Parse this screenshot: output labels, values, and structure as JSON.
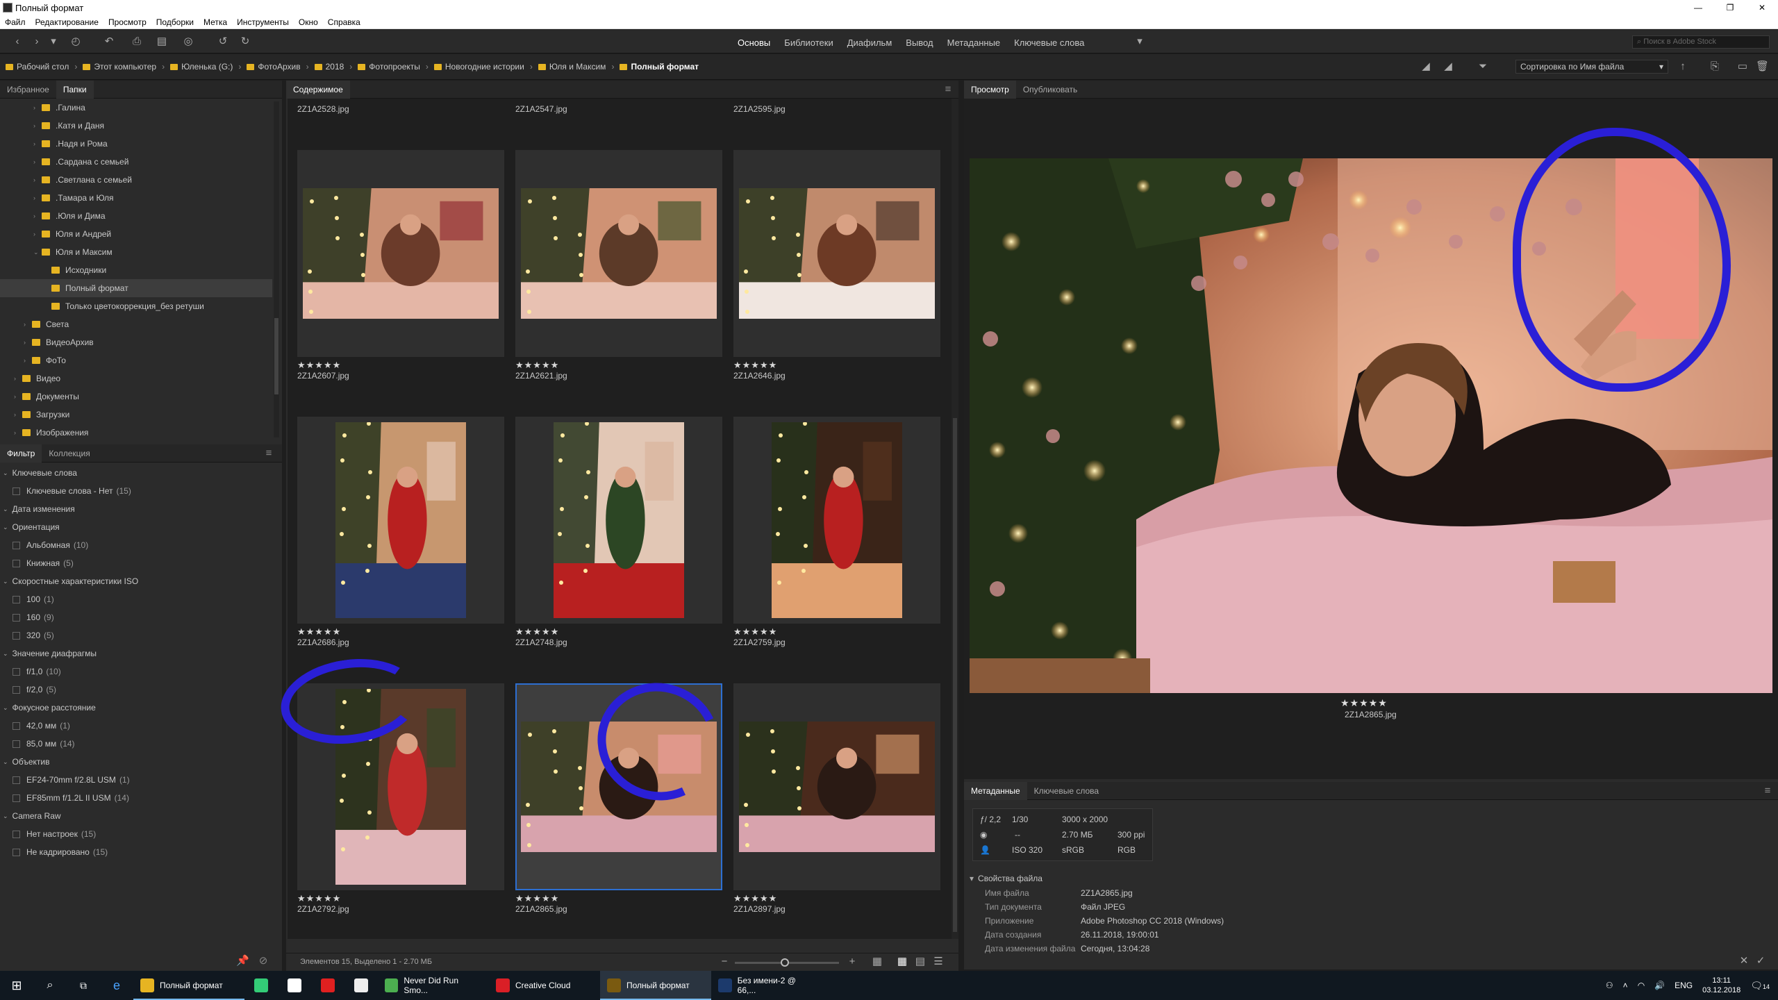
{
  "window": {
    "title": "Полный формат"
  },
  "menu": [
    "Файл",
    "Редактирование",
    "Просмотр",
    "Подборки",
    "Метка",
    "Инструменты",
    "Окно",
    "Справка"
  ],
  "workspaces": [
    "Основы",
    "Библиотеки",
    "Диафильм",
    "Вывод",
    "Метаданные",
    "Ключевые слова"
  ],
  "stock_placeholder": "Поиск в Adobe Stock",
  "breadcrumb": [
    "Рабочий стол",
    "Этот компьютер",
    "Юленька (G:)",
    "ФотоАрхив",
    "2018",
    "Фотопроекты",
    "Новогодние истории",
    "Юля и Максим",
    "Полный формат"
  ],
  "sort_label": "Сортировка по Имя файла",
  "left_tabs": [
    "Избранное",
    "Папки"
  ],
  "folders": [
    {
      "label": ".Галина",
      "indent": 2,
      "sel": false
    },
    {
      "label": ".Катя и Даня",
      "indent": 2,
      "sel": false
    },
    {
      "label": ".Надя и Рома",
      "indent": 2,
      "sel": false
    },
    {
      "label": ".Сардана с семьей",
      "indent": 2,
      "sel": false
    },
    {
      "label": ".Светлана с семьей",
      "indent": 2,
      "sel": false
    },
    {
      "label": ".Тамара и Юля",
      "indent": 2,
      "sel": false
    },
    {
      "label": ".Юля и Дима",
      "indent": 2,
      "sel": false
    },
    {
      "label": "Юля и Андрей",
      "indent": 2,
      "sel": false
    },
    {
      "label": "Юля и Максим",
      "indent": 2,
      "sel": false
    },
    {
      "label": "Исходники",
      "indent": 3,
      "sel": false
    },
    {
      "label": "Полный формат",
      "indent": 3,
      "sel": true
    },
    {
      "label": "Только цветокоррекция_без ретуши",
      "indent": 3,
      "sel": false
    },
    {
      "label": "Света",
      "indent": 1,
      "sel": false
    },
    {
      "label": "ВидеоАрхив",
      "indent": 1,
      "sel": false
    },
    {
      "label": "ФоТо",
      "indent": 1,
      "sel": false
    },
    {
      "label": "Видео",
      "indent": 0,
      "sel": false
    },
    {
      "label": "Документы",
      "indent": 0,
      "sel": false
    },
    {
      "label": "Загрузки",
      "indent": 0,
      "sel": false
    },
    {
      "label": "Изображения",
      "indent": 0,
      "sel": false
    }
  ],
  "filter_tabs": [
    "Фильтр",
    "Коллекция"
  ],
  "filters": [
    {
      "type": "h",
      "label": "Ключевые слова"
    },
    {
      "type": "i",
      "label": "Ключевые слова - Нет",
      "count": "(15)"
    },
    {
      "type": "h",
      "label": "Дата изменения"
    },
    {
      "type": "h",
      "label": "Ориентация"
    },
    {
      "type": "i",
      "label": "Альбомная",
      "count": "(10)"
    },
    {
      "type": "i",
      "label": "Книжная",
      "count": "(5)"
    },
    {
      "type": "h",
      "label": "Скоростные характеристики ISO"
    },
    {
      "type": "i",
      "label": "100",
      "count": "(1)"
    },
    {
      "type": "i",
      "label": "160",
      "count": "(9)"
    },
    {
      "type": "i",
      "label": "320",
      "count": "(5)"
    },
    {
      "type": "h",
      "label": "Значение диафрагмы"
    },
    {
      "type": "i",
      "label": "f/1,0",
      "count": "(10)"
    },
    {
      "type": "i",
      "label": "f/2,0",
      "count": "(5)"
    },
    {
      "type": "h",
      "label": "Фокусное расстояние"
    },
    {
      "type": "i",
      "label": "42,0 мм",
      "count": "(1)"
    },
    {
      "type": "i",
      "label": "85,0 мм",
      "count": "(14)"
    },
    {
      "type": "h",
      "label": "Объектив"
    },
    {
      "type": "i",
      "label": "EF24-70mm f/2.8L USM",
      "count": "(1)"
    },
    {
      "type": "i",
      "label": "EF85mm f/1.2L II USM",
      "count": "(14)"
    },
    {
      "type": "h",
      "label": "Camera Raw"
    },
    {
      "type": "i",
      "label": "Нет настроек",
      "count": "(15)"
    },
    {
      "type": "i",
      "label": "Не кадрировано",
      "count": "(15)"
    }
  ],
  "content_tab": "Содержимое",
  "top_names": [
    "2Z1A2528.jpg",
    "2Z1A2547.jpg",
    "2Z1A2595.jpg"
  ],
  "thumbs": [
    {
      "name": "2Z1A2607.jpg",
      "stars": "★★★★★",
      "orient": "land",
      "palette": [
        "#c98f73",
        "#6b3b2a",
        "#e4b6a6",
        "#8a1f2b"
      ],
      "sel": false
    },
    {
      "name": "2Z1A2621.jpg",
      "stars": "★★★★★",
      "orient": "land",
      "palette": [
        "#cf9274",
        "#5c3a28",
        "#e8c1b2",
        "#2d4b22"
      ],
      "sel": false
    },
    {
      "name": "2Z1A2646.jpg",
      "stars": "★★★★★",
      "orient": "land",
      "palette": [
        "#c08a6c",
        "#6d3a25",
        "#f0e6e0",
        "#3a2a22"
      ],
      "sel": false
    },
    {
      "name": "2Z1A2686.jpg",
      "stars": "★★★★★",
      "orient": "port",
      "palette": [
        "#c7976f",
        "#b82020",
        "#2b3a6c",
        "#e8cfc0"
      ],
      "sel": false
    },
    {
      "name": "2Z1A2748.jpg",
      "stars": "★★★★★",
      "orient": "port",
      "palette": [
        "#e2c7b5",
        "#2c4624",
        "#b82020",
        "#d8b09a"
      ],
      "sel": false
    },
    {
      "name": "2Z1A2759.jpg",
      "stars": "★★★★★",
      "orient": "port",
      "palette": [
        "#3a2418",
        "#b82020",
        "#e0a070",
        "#5b3520"
      ],
      "sel": false
    },
    {
      "name": "2Z1A2792.jpg",
      "stars": "★★★★★",
      "orient": "port",
      "palette": [
        "#5a3a2a",
        "#c02a2a",
        "#e0b5b8",
        "#2e4a28"
      ],
      "sel": false
    },
    {
      "name": "2Z1A2865.jpg",
      "stars": "★★★★★",
      "orient": "land",
      "palette": [
        "#c88c6c",
        "#2a1a14",
        "#d8a3ad",
        "#f0a0a0"
      ],
      "sel": true
    },
    {
      "name": "2Z1A2897.jpg",
      "stars": "★★★★★",
      "orient": "land",
      "palette": [
        "#4a2a1c",
        "#2a1a14",
        "#d8a3ad",
        "#e0a070"
      ],
      "sel": false
    }
  ],
  "status_text": "Элементов 15, Выделено 1 - 2.70 МБ",
  "right_tabs": [
    "Просмотр",
    "Опубликовать"
  ],
  "preview": {
    "stars": "★★★★★",
    "name": "2Z1A2865.jpg"
  },
  "meta_tabs": [
    "Метаданные",
    "Ключевые слова"
  ],
  "meta_box": {
    "aperture": "ƒ/ 2,2",
    "shutter": "1/30",
    "dims": "3000 x 2000",
    "exp": "--",
    "size": "2.70 МБ",
    "ppi": "300 ppi",
    "iso": "ISO 320",
    "space": "sRGB",
    "mode": "RGB"
  },
  "file_props_title": "Свойства файла",
  "file_props": [
    {
      "k": "Имя файла",
      "v": "2Z1A2865.jpg"
    },
    {
      "k": "Тип документа",
      "v": "Файл JPEG"
    },
    {
      "k": "Приложение",
      "v": "Adobe Photoshop CC 2018 (Windows)"
    },
    {
      "k": "Дата создания",
      "v": "26.11.2018, 19:00:01"
    },
    {
      "k": "Дата изменения файла",
      "v": "Сегодня, 13:04:28"
    }
  ],
  "taskbar": [
    {
      "label": "Полный формат",
      "color": "#e6b422",
      "act": true
    },
    {
      "label": "",
      "color": "#3c7",
      "act": false
    },
    {
      "label": "",
      "color": "#fff",
      "act": false
    },
    {
      "label": "",
      "color": "#e02020",
      "act": false
    },
    {
      "label": "",
      "color": "#eee",
      "act": false
    },
    {
      "label": "Never Did Run Smo...",
      "color": "#4caf50",
      "act": false
    },
    {
      "label": "Creative Cloud",
      "color": "#da1f26",
      "act": false
    },
    {
      "label": "Полный формат",
      "color": "#7a5a10",
      "act": true
    },
    {
      "label": "Без имени-2 @ 66,...",
      "color": "#1c3a6c",
      "act": false
    }
  ],
  "tray": {
    "lang": "ENG",
    "time": "13:11",
    "date": "03.12.2018",
    "notif": "14"
  },
  "colors": {
    "accent": "#2d6fd2",
    "annotation": "#2a1fd6",
    "folder": "#e6b422"
  }
}
